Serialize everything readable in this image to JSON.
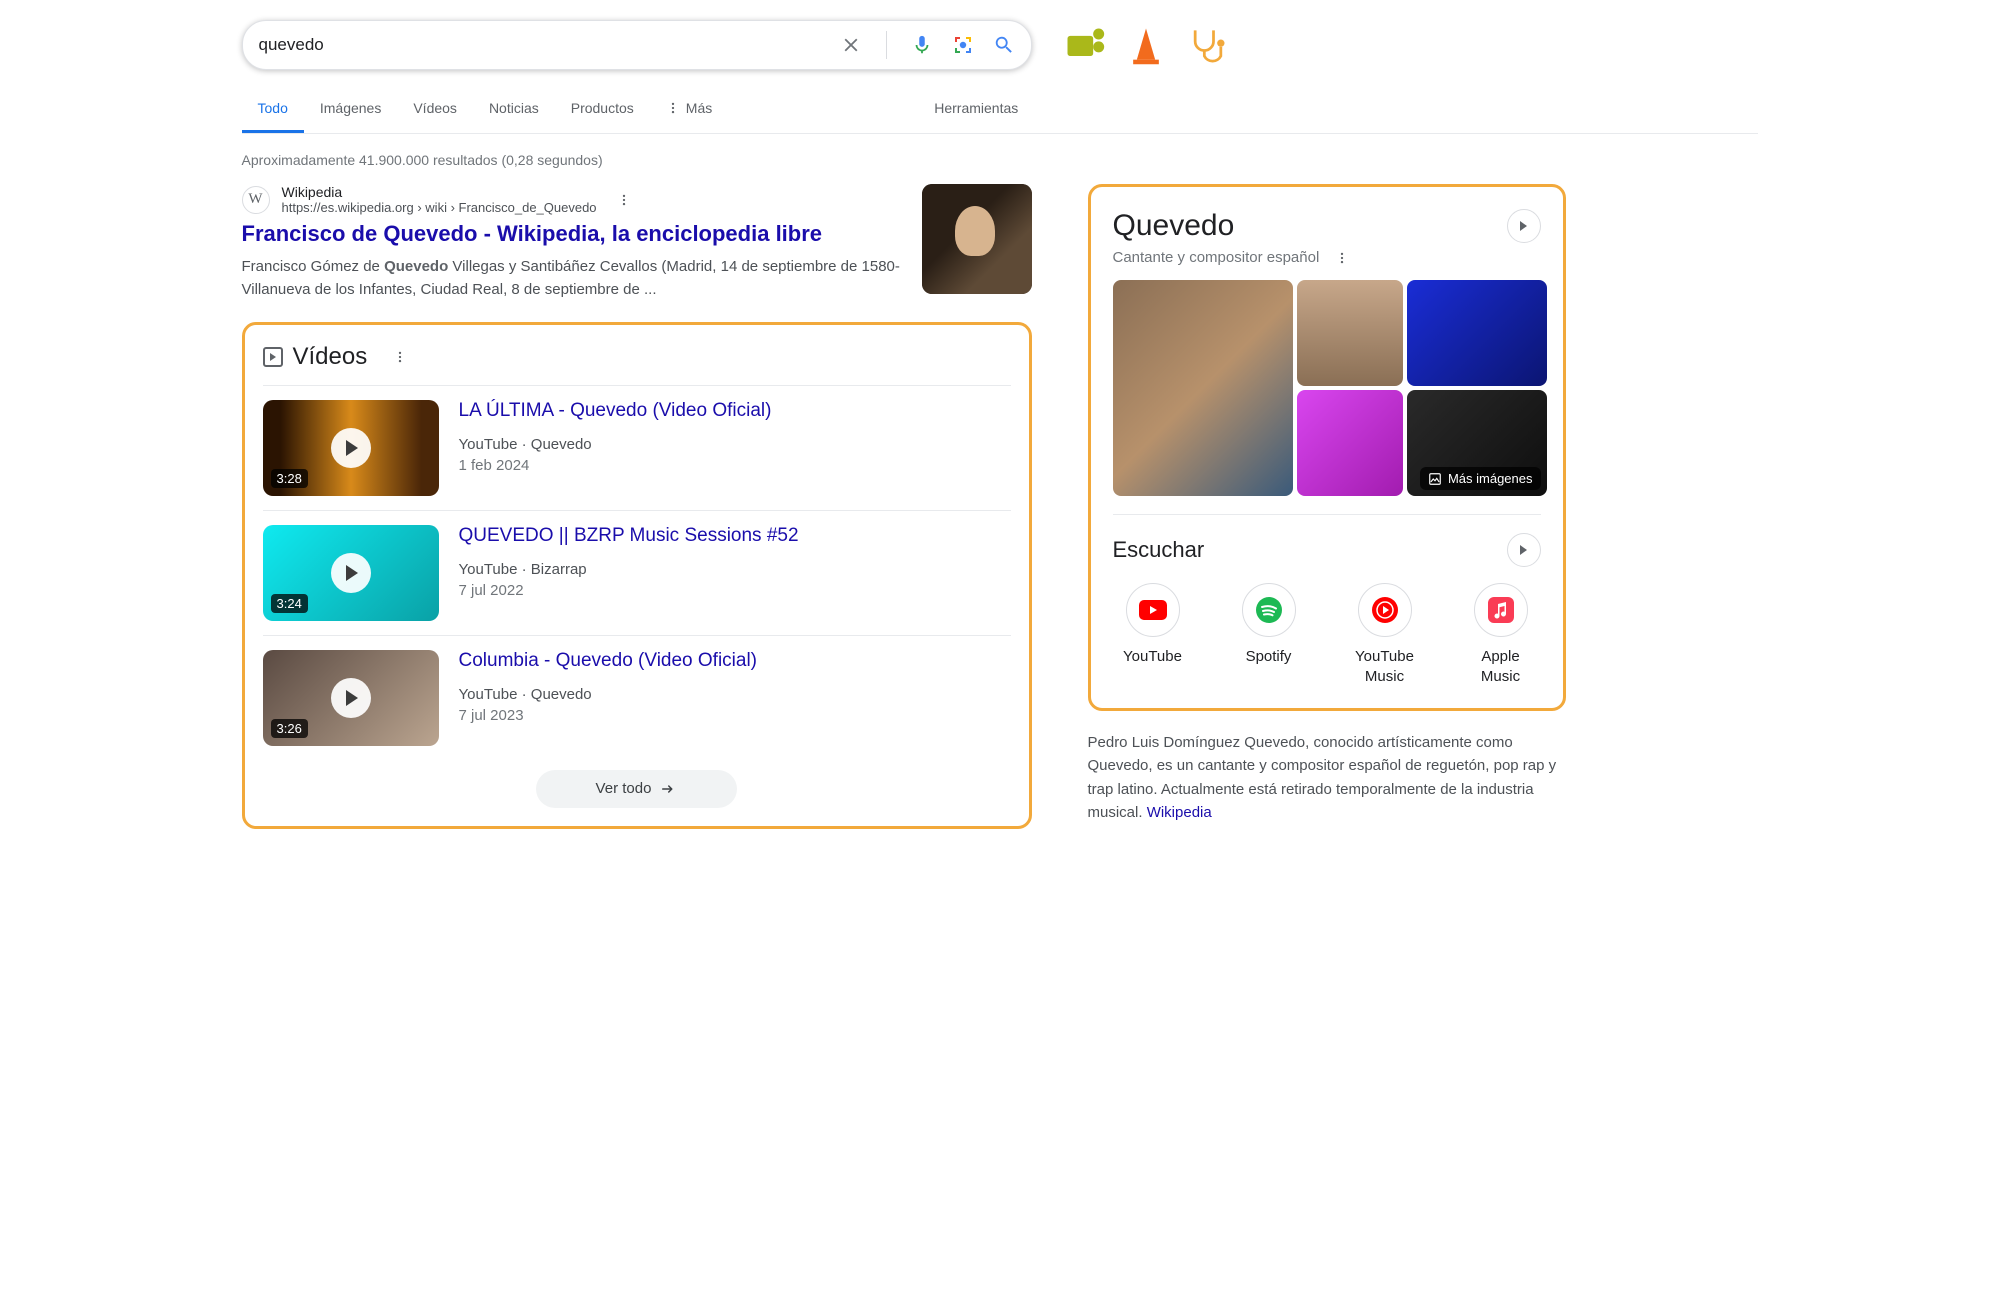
{
  "search": {
    "query": "quevedo"
  },
  "tabs": [
    "Todo",
    "Imágenes",
    "Vídeos",
    "Noticias",
    "Productos",
    "Más"
  ],
  "tools_label": "Herramientas",
  "stats": "Aproximadamente 41.900.000 resultados (0,28 segundos)",
  "result1": {
    "source_name": "Wikipedia",
    "url": "https://es.wikipedia.org › wiki › Francisco_de_Quevedo",
    "title": "Francisco de Quevedo - Wikipedia, la enciclopedia libre",
    "snippet_pre": "Francisco Gómez de ",
    "snippet_bold": "Quevedo",
    "snippet_post": " Villegas y Santibáñez Cevallos (Madrid, 14 de septiembre de 1580-Villanueva de los Infantes, Ciudad Real, 8 de septiembre de ..."
  },
  "videos": {
    "heading": "Vídeos",
    "items": [
      {
        "title": "LA ÚLTIMA - Quevedo (Video Oficial)",
        "source": "YouTube · Quevedo",
        "date": "1 feb 2024",
        "duration": "3:28"
      },
      {
        "title": "QUEVEDO || BZRP Music Sessions #52",
        "source": "YouTube · Bizarrap",
        "date": "7 jul 2022",
        "duration": "3:24"
      },
      {
        "title": "Columbia - Quevedo (Video Oficial)",
        "source": "YouTube · Quevedo",
        "date": "7 jul 2023",
        "duration": "3:26"
      }
    ],
    "see_all": "Ver todo"
  },
  "kp": {
    "title": "Quevedo",
    "subtitle": "Cantante y compositor español",
    "more_images": "Más imágenes",
    "listen_heading": "Escuchar",
    "listen": [
      {
        "label": "YouTube"
      },
      {
        "label": "Spotify"
      },
      {
        "label": "YouTube Music"
      },
      {
        "label": "Apple Music"
      }
    ],
    "description": "Pedro Luis Domínguez Quevedo, conocido artísticamente como Quevedo, es un cantante y compositor español de reguetón, pop rap y trap latino. Actualmente está retirado temporalmente de la industria musical. ",
    "description_link": "Wikipedia"
  }
}
